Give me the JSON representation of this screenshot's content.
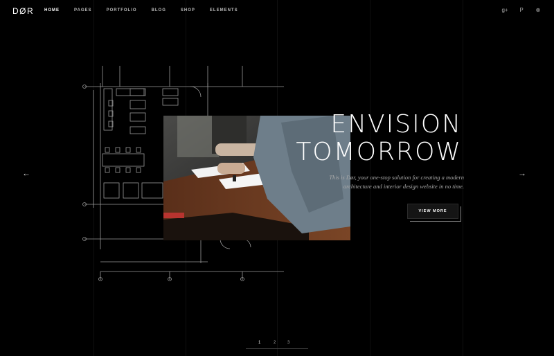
{
  "header": {
    "logo": "DØR",
    "nav": [
      "HOME",
      "PAGES",
      "PORTFOLIO",
      "BLOG",
      "SHOP",
      "ELEMENTS"
    ],
    "active_nav": "HOME",
    "social": [
      {
        "icon": "google-plus-icon",
        "glyph": "g+"
      },
      {
        "icon": "pinterest-icon",
        "glyph": "P"
      },
      {
        "icon": "dribbble-icon",
        "glyph": "⊗"
      }
    ]
  },
  "hero": {
    "title_line1": "ENVISION",
    "title_line2": "TOMORROW",
    "subtitle": "This is Dør, your one-stop solution for creating a modern architecture and interior design website in no time.",
    "button_label": "VIEW MORE"
  },
  "slider": {
    "prev_glyph": "←",
    "next_glyph": "→",
    "pages": [
      "1",
      "2",
      "3"
    ],
    "active_page": "1"
  },
  "colors": {
    "background": "#000000",
    "text": "#ffffff",
    "muted": "#aaaaaa"
  }
}
